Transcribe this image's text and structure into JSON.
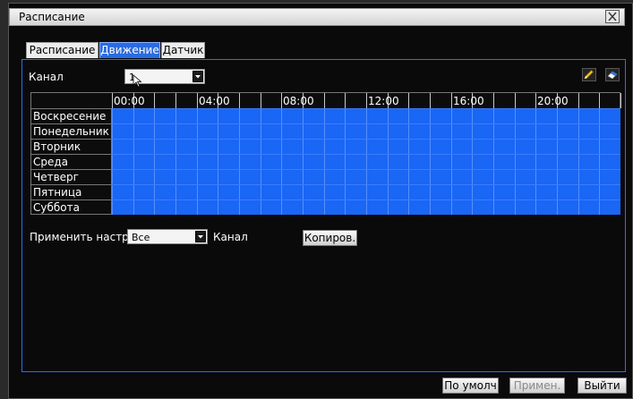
{
  "window": {
    "title": "Расписание"
  },
  "tabs": [
    {
      "label": "Расписание",
      "active": false
    },
    {
      "label": "Движение",
      "active": true
    },
    {
      "label": "Датчик",
      "active": false
    }
  ],
  "channel": {
    "label": "Канал",
    "value": "1"
  },
  "schedule": {
    "hour_labels": [
      "00:00",
      "04:00",
      "08:00",
      "12:00",
      "16:00",
      "20:00"
    ],
    "days": [
      "Воскресение",
      "Понедельник",
      "Вторник",
      "Среда",
      "Четверг",
      "Пятница",
      "Суббота"
    ]
  },
  "apply": {
    "label": "Применить настр",
    "value": "Все",
    "suffix": "Канал",
    "copy_label": "Копиров."
  },
  "buttons": {
    "default_label": "По умолч",
    "apply_label": "Примен.",
    "exit_label": "Выйти"
  },
  "colors": {
    "schedule_fill": "#1a66f5",
    "tab_active": "#2a6ce0",
    "panel_border": "#2f6df0"
  },
  "icons": {
    "close": "close-icon",
    "edit": "pencil-icon",
    "erase": "eraser-icon",
    "dropdown": "chevron-down-icon"
  }
}
